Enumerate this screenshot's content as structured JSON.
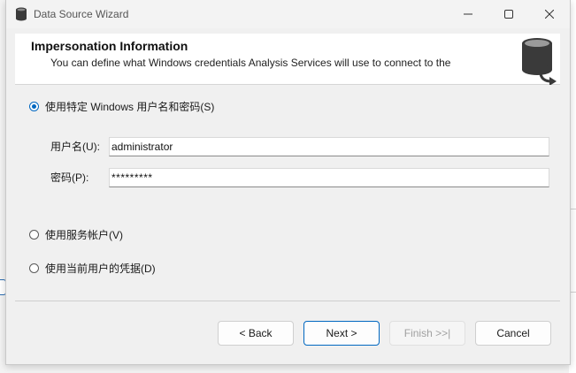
{
  "window": {
    "title": "Data Source Wizard"
  },
  "header": {
    "title": "Impersonation Information",
    "description": "You can define what Windows credentials Analysis Services will use to connect to the"
  },
  "options": {
    "specific_account": "使用特定 Windows 用户名和密码(S)",
    "service_account": "使用服务帐户(V)",
    "current_user": "使用当前用户的凭据(D)",
    "selected": "specific_account"
  },
  "credentials": {
    "username_label": "用户名(U):",
    "username_value": "administrator",
    "password_label": "密码(P):",
    "password_value": "*********"
  },
  "buttons": {
    "back": "< Back",
    "next": "Next >",
    "finish": "Finish >>|",
    "cancel": "Cancel"
  },
  "colors": {
    "accent": "#0067c0",
    "header_bg": "#ffffff",
    "dialog_bg": "#f0f0f0",
    "icon_gray": "#3a3a3a"
  }
}
